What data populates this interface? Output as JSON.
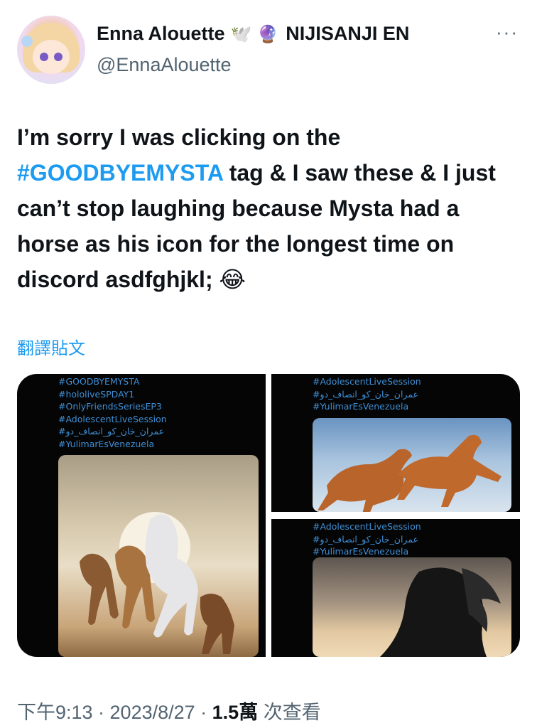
{
  "tweet": {
    "display_name": "Enna Alouette",
    "name_emoji_1": "🕊️",
    "name_emoji_2": "🔮",
    "name_suffix": "NIJISANJI EN",
    "handle": "@EnnaAlouette",
    "more": "···",
    "text_part1": "I’m sorry I was clicking on the ",
    "hashtag": "#GOODBYEMYSTA",
    "text_part2": " tag & I saw these & I just can’t stop laughing because Mysta had a horse as his icon for the longest time on discord asdfghjkl; 😂",
    "translate_label": "翻譯貼文",
    "timestamp": "下午9:13 · 2023/8/27 · ",
    "views_count": "1.5萬",
    "views_label": " 次查看"
  },
  "media": {
    "left_tags": [
      "#GOODBYEMYSTA",
      "#hololiveSPDAY1",
      "#OnlyFriendsSeriesEP3",
      "#AdolescentLiveSession",
      "#عمران_خان_کو_انصاف_دو",
      "#YulimarEsVenezuela"
    ],
    "top_right_tags": [
      "#AdolescentLiveSession",
      "#عمران_خان_کو_انصاف_دو",
      "#YulimarEsVenezuela"
    ],
    "bottom_right_tags": [
      "#AdolescentLiveSession",
      "#عمران_خان_کو_انصاف_دو",
      "#YulimarEsVenezuela"
    ]
  }
}
